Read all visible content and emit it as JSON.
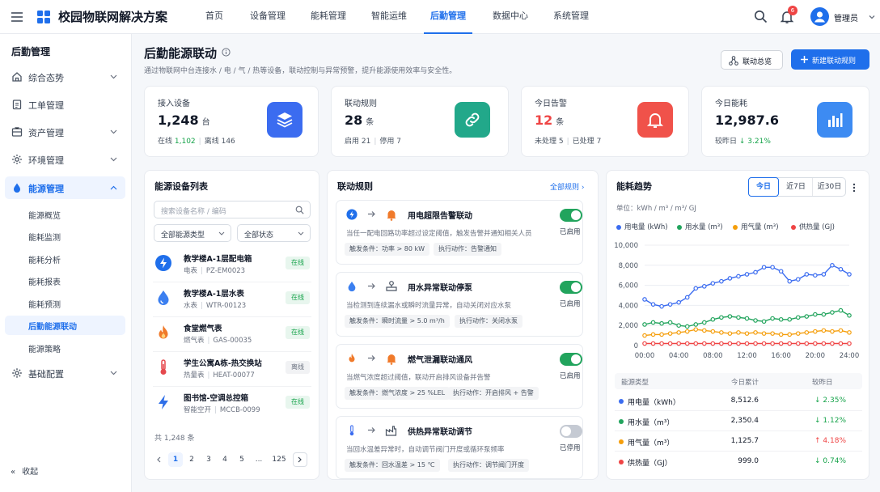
{
  "app": {
    "title": "校园物联网解决方案"
  },
  "nav": [
    {
      "label": "首页",
      "active": false
    },
    {
      "label": "设备管理",
      "active": false
    },
    {
      "label": "能耗管理",
      "active": false
    },
    {
      "label": "智能运维",
      "active": false
    },
    {
      "label": "后勤管理",
      "active": true
    },
    {
      "label": "数据中心",
      "active": false
    },
    {
      "label": "系统管理",
      "active": false
    }
  ],
  "header": {
    "notification_count": "6",
    "user_name": "管理员"
  },
  "sidebar": {
    "title": "后勤管理",
    "items": [
      {
        "label": "综合态势",
        "icon": "dashboard-icon"
      },
      {
        "label": "工单管理",
        "icon": "clipboard-icon"
      },
      {
        "label": "资产管理",
        "icon": "asset-icon"
      },
      {
        "label": "环境管理",
        "icon": "environment-icon"
      },
      {
        "label": "能源管理",
        "icon": "water-drop-icon",
        "active": true
      },
      {
        "label": "基础配置",
        "icon": "gear-icon"
      }
    ],
    "sub_items": [
      {
        "label": "能源概览"
      },
      {
        "label": "能耗监测"
      },
      {
        "label": "能耗分析"
      },
      {
        "label": "能耗报表"
      },
      {
        "label": "能耗预测"
      },
      {
        "label": "后勤能源联动",
        "active": true
      },
      {
        "label": "能源策略"
      }
    ],
    "collapse_label": "收起"
  },
  "page": {
    "title": "后勤能源联动",
    "description": "通过物联网中台连接水 / 电 / 气 / 热等设备，联动控制与异常预警，提升能源使用效率与安全性。",
    "overview_button": "联动总览",
    "new_rule_button": "新建联动规则"
  },
  "stats": [
    {
      "label": "接入设备",
      "value": "1,248",
      "unit": "台",
      "sub": [
        {
          "text": "在线",
          "val": "1,102",
          "color": "green"
        },
        {
          "text": "离线",
          "val": "146",
          "color": ""
        }
      ],
      "icon": "layers-icon",
      "color": "#3b6cf0"
    },
    {
      "label": "联动规则",
      "value": "28",
      "unit": "条",
      "sub": [
        {
          "text": "启用",
          "val": "21",
          "color": ""
        },
        {
          "text": "停用",
          "val": "7",
          "color": ""
        }
      ],
      "icon": "link-icon",
      "color": "#22a88a"
    },
    {
      "label": "今日告警",
      "value": "12",
      "unit": "条",
      "value_color": "#ef4444",
      "sub": [
        {
          "text": "未处理",
          "val": "5",
          "color": ""
        },
        {
          "text": "已处理",
          "val": "7",
          "color": ""
        }
      ],
      "icon": "bell-icon",
      "color": "#f0524a"
    },
    {
      "label": "今日能耗",
      "value": "12,987.6",
      "unit": "",
      "sub": [
        {
          "text": "较昨日",
          "val": "↓ 3.21%",
          "color": "green"
        }
      ],
      "icon": "bar-chart-icon",
      "color": "#3d8bf2"
    }
  ],
  "devices": {
    "title": "能源设备列表",
    "search_placeholder": "搜索设备名称 / 编码",
    "type_filter": "全部能源类型",
    "status_filter": "全部状态",
    "rows": [
      {
        "name": "教学楼A-1层配电箱",
        "type": "电表",
        "code": "PZ-EM0023",
        "status": "在线",
        "online": true,
        "icon": "lightning-icon"
      },
      {
        "name": "教学楼A-1层水表",
        "type": "水表",
        "code": "WTR-00123",
        "status": "在线",
        "online": true,
        "icon": "water-drop-icon"
      },
      {
        "name": "食堂燃气表",
        "type": "燃气表",
        "code": "GAS-00035",
        "status": "在线",
        "online": true,
        "icon": "flame-icon"
      },
      {
        "name": "学生公寓A栋-热交换站",
        "type": "热量表",
        "code": "HEAT-00077",
        "status": "离线",
        "online": false,
        "icon": "thermometer-icon"
      },
      {
        "name": "图书馆-空调总控箱",
        "type": "智能空开",
        "code": "MCCB-0099",
        "status": "在线",
        "online": true,
        "icon": "lightning-icon"
      }
    ],
    "total": "共 1,248 条",
    "pages": [
      "1",
      "2",
      "3",
      "4",
      "5",
      "...",
      "125"
    ]
  },
  "rules": {
    "title": "联动规则",
    "all_link": "全部规则",
    "items": [
      {
        "name": "用电超限告警联动",
        "desc": "当任一配电回路功率超过设定阈值，触发告警并通知相关人员",
        "cond": "触发条件：功率 > 80 kW",
        "action": "执行动作：告警通知",
        "enabled": true,
        "status": "已启用",
        "icon1": "lightning-icon",
        "icon2": "bell-icon"
      },
      {
        "name": "用水异常联动停泵",
        "desc": "当检测到连续漏水或瞬时流量异常，自动关闭对应水泵",
        "cond": "触发条件：瞬时流量 > 5.0 m³/h",
        "action": "执行动作：关闭水泵",
        "enabled": true,
        "status": "已启用",
        "icon1": "water-drop-icon",
        "icon2": "valve-icon"
      },
      {
        "name": "燃气泄漏联动通风",
        "desc": "当燃气浓度超过阈值，联动开启排风设备并告警",
        "cond": "触发条件：燃气浓度 > 25 %LEL",
        "action": "执行动作：开启排风 + 告警",
        "enabled": true,
        "status": "已启用",
        "icon1": "flame-icon",
        "icon2": "bell-icon"
      },
      {
        "name": "供热异常联动调节",
        "desc": "当回水温差异常时，自动调节阀门开度或循环泵频率",
        "cond": "触发条件：回水温差 > 15 ℃",
        "action": "执行动作：调节阀门开度",
        "enabled": false,
        "status": "已停用",
        "icon1": "thermometer-icon",
        "icon2": "factory-icon"
      }
    ]
  },
  "trend": {
    "title": "能耗趋势",
    "tabs": [
      "今日",
      "近7日",
      "近30日"
    ],
    "active_tab": "今日",
    "unit_label": "单位：kWh / m³ / m³/ GJ",
    "table_headers": [
      "能源类型",
      "今日累计",
      "较昨日"
    ],
    "table_rows": [
      {
        "name": "用电量（kWh）",
        "value": "8,512.6",
        "change": "↓ 2.35%",
        "dir": "down",
        "color": "#3b6cf0"
      },
      {
        "name": "用水量（m³）",
        "value": "2,350.4",
        "change": "↓ 1.12%",
        "dir": "down",
        "color": "#22a45d"
      },
      {
        "name": "用气量（m³）",
        "value": "1,125.7",
        "change": "↑ 4.18%",
        "dir": "up",
        "color": "#f59e0b"
      },
      {
        "name": "供热量（GJ）",
        "value": "999.0",
        "change": "↓ 0.74%",
        "dir": "down",
        "color": "#ef4444"
      }
    ]
  },
  "chart_data": {
    "type": "line",
    "x": [
      "00:00",
      "01:00",
      "02:00",
      "03:00",
      "04:00",
      "05:00",
      "06:00",
      "07:00",
      "08:00",
      "09:00",
      "10:00",
      "11:00",
      "12:00",
      "13:00",
      "14:00",
      "15:00",
      "16:00",
      "17:00",
      "18:00",
      "19:00",
      "20:00",
      "21:00",
      "22:00",
      "23:00",
      "24:00"
    ],
    "x_ticks": [
      "00:00",
      "04:00",
      "08:00",
      "12:00",
      "16:00",
      "20:00",
      "24:00"
    ],
    "ylim": [
      0,
      10000
    ],
    "y_ticks": [
      "0",
      "2,000",
      "4,000",
      "6,000",
      "8,000",
      "10,000"
    ],
    "grid": true,
    "legend_position": "top",
    "series": [
      {
        "name": "用电量 (kWh)",
        "color": "#3b6cf0",
        "values": [
          4600,
          4100,
          3900,
          4100,
          4300,
          4800,
          5700,
          5900,
          6200,
          6400,
          6700,
          6900,
          7100,
          7300,
          7800,
          7800,
          7400,
          6400,
          6600,
          7100,
          7000,
          7100,
          8000,
          7600,
          7100
        ]
      },
      {
        "name": "用水量 (m³)",
        "color": "#22a45d",
        "values": [
          2100,
          2300,
          2200,
          2300,
          2000,
          1900,
          2100,
          2300,
          2600,
          2800,
          2900,
          2800,
          2700,
          2500,
          2400,
          2700,
          2600,
          2600,
          2800,
          2900,
          3100,
          3100,
          3300,
          3500,
          3000
        ]
      },
      {
        "name": "用气量 (m³)",
        "color": "#f59e0b",
        "values": [
          1000,
          1100,
          1100,
          1200,
          1300,
          1400,
          1600,
          1500,
          1400,
          1300,
          1200,
          1300,
          1200,
          1300,
          1200,
          1200,
          1100,
          1100,
          1200,
          1300,
          1400,
          1500,
          1400,
          1500,
          1300
        ]
      },
      {
        "name": "供热量 (GJ)",
        "color": "#ef4444",
        "values": [
          200,
          200,
          200,
          200,
          200,
          200,
          200,
          200,
          200,
          200,
          200,
          200,
          200,
          200,
          200,
          200,
          200,
          200,
          200,
          200,
          200,
          200,
          200,
          200,
          200
        ]
      }
    ]
  }
}
